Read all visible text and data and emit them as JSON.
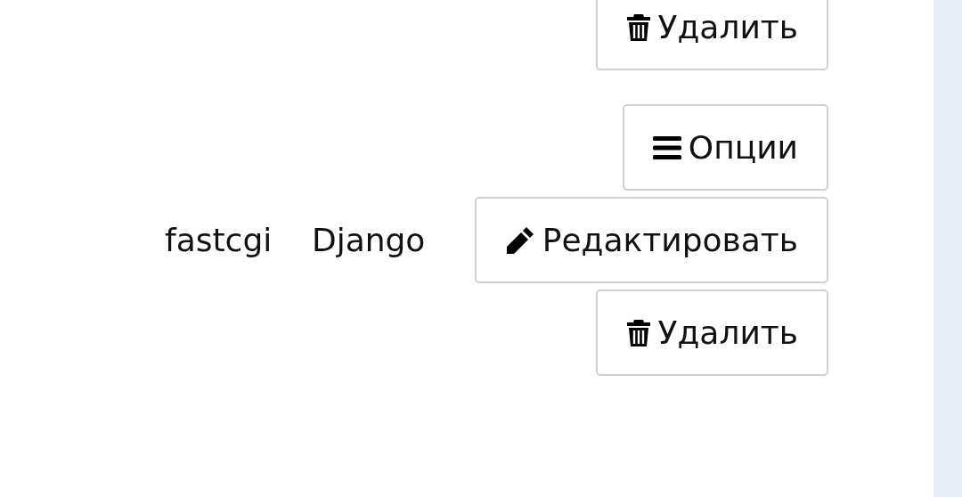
{
  "rows": [
    {
      "cells": [],
      "actions": [
        {
          "kind": "delete",
          "label": "Удалить"
        }
      ]
    },
    {
      "cells": [
        "fastcgi",
        "Django"
      ],
      "actions": [
        {
          "kind": "options",
          "label": "Опции"
        },
        {
          "kind": "edit",
          "label": "Редактировать"
        },
        {
          "kind": "delete",
          "label": "Удалить"
        }
      ]
    }
  ]
}
